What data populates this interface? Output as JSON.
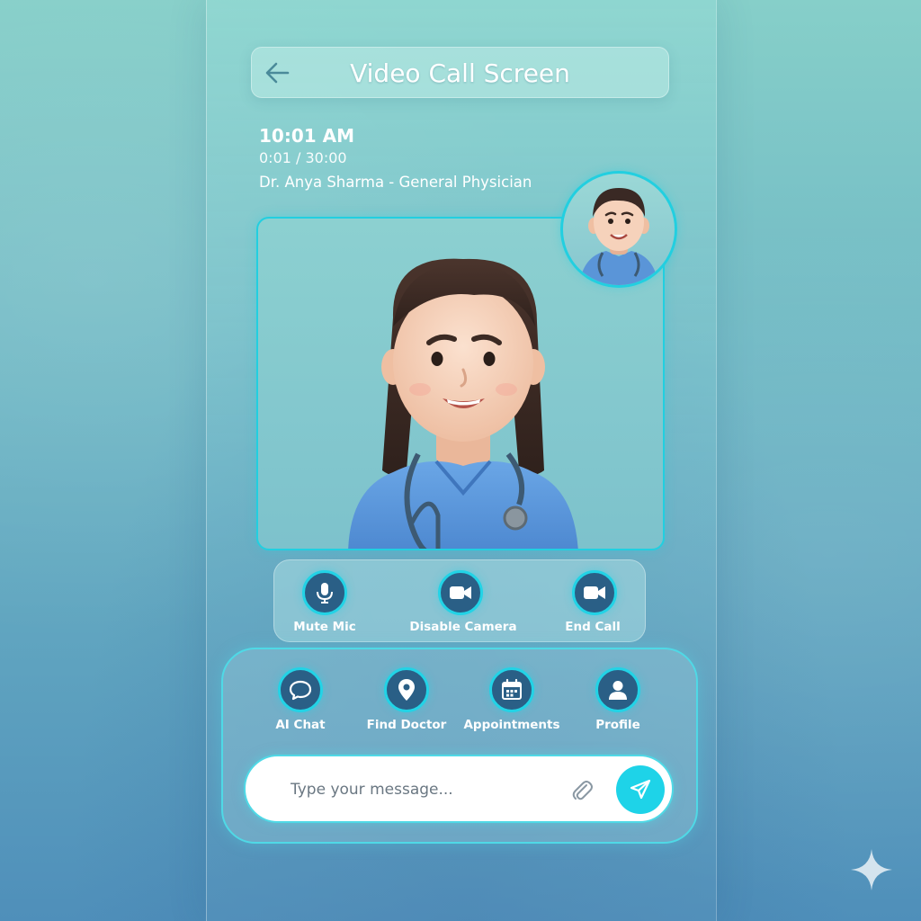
{
  "header": {
    "title": "Video Call Screen",
    "back_icon": "arrow-left-icon"
  },
  "call_info": {
    "time": "10:01 AM",
    "duration": "0:01 / 30:00",
    "doctor": "Dr. Anya Sharma - General Physician"
  },
  "call_controls": [
    {
      "label": "Mute Mic",
      "icon": "microphone-icon"
    },
    {
      "label": "Disable Camera",
      "icon": "video-camera-icon"
    },
    {
      "label": "End Call",
      "icon": "video-camera-icon"
    }
  ],
  "nav": [
    {
      "label": "AI Chat",
      "icon": "chat-bubble-icon"
    },
    {
      "label": "Find Doctor",
      "icon": "location-pin-icon"
    },
    {
      "label": "Appointments",
      "icon": "calendar-icon"
    },
    {
      "label": "Profile",
      "icon": "user-icon"
    }
  ],
  "message": {
    "placeholder": "Type your message..."
  },
  "colors": {
    "accent": "#22cfe0",
    "button_fill": "#2a5f86",
    "scrubs": "#5a95d8",
    "send": "#1ed3e8"
  }
}
